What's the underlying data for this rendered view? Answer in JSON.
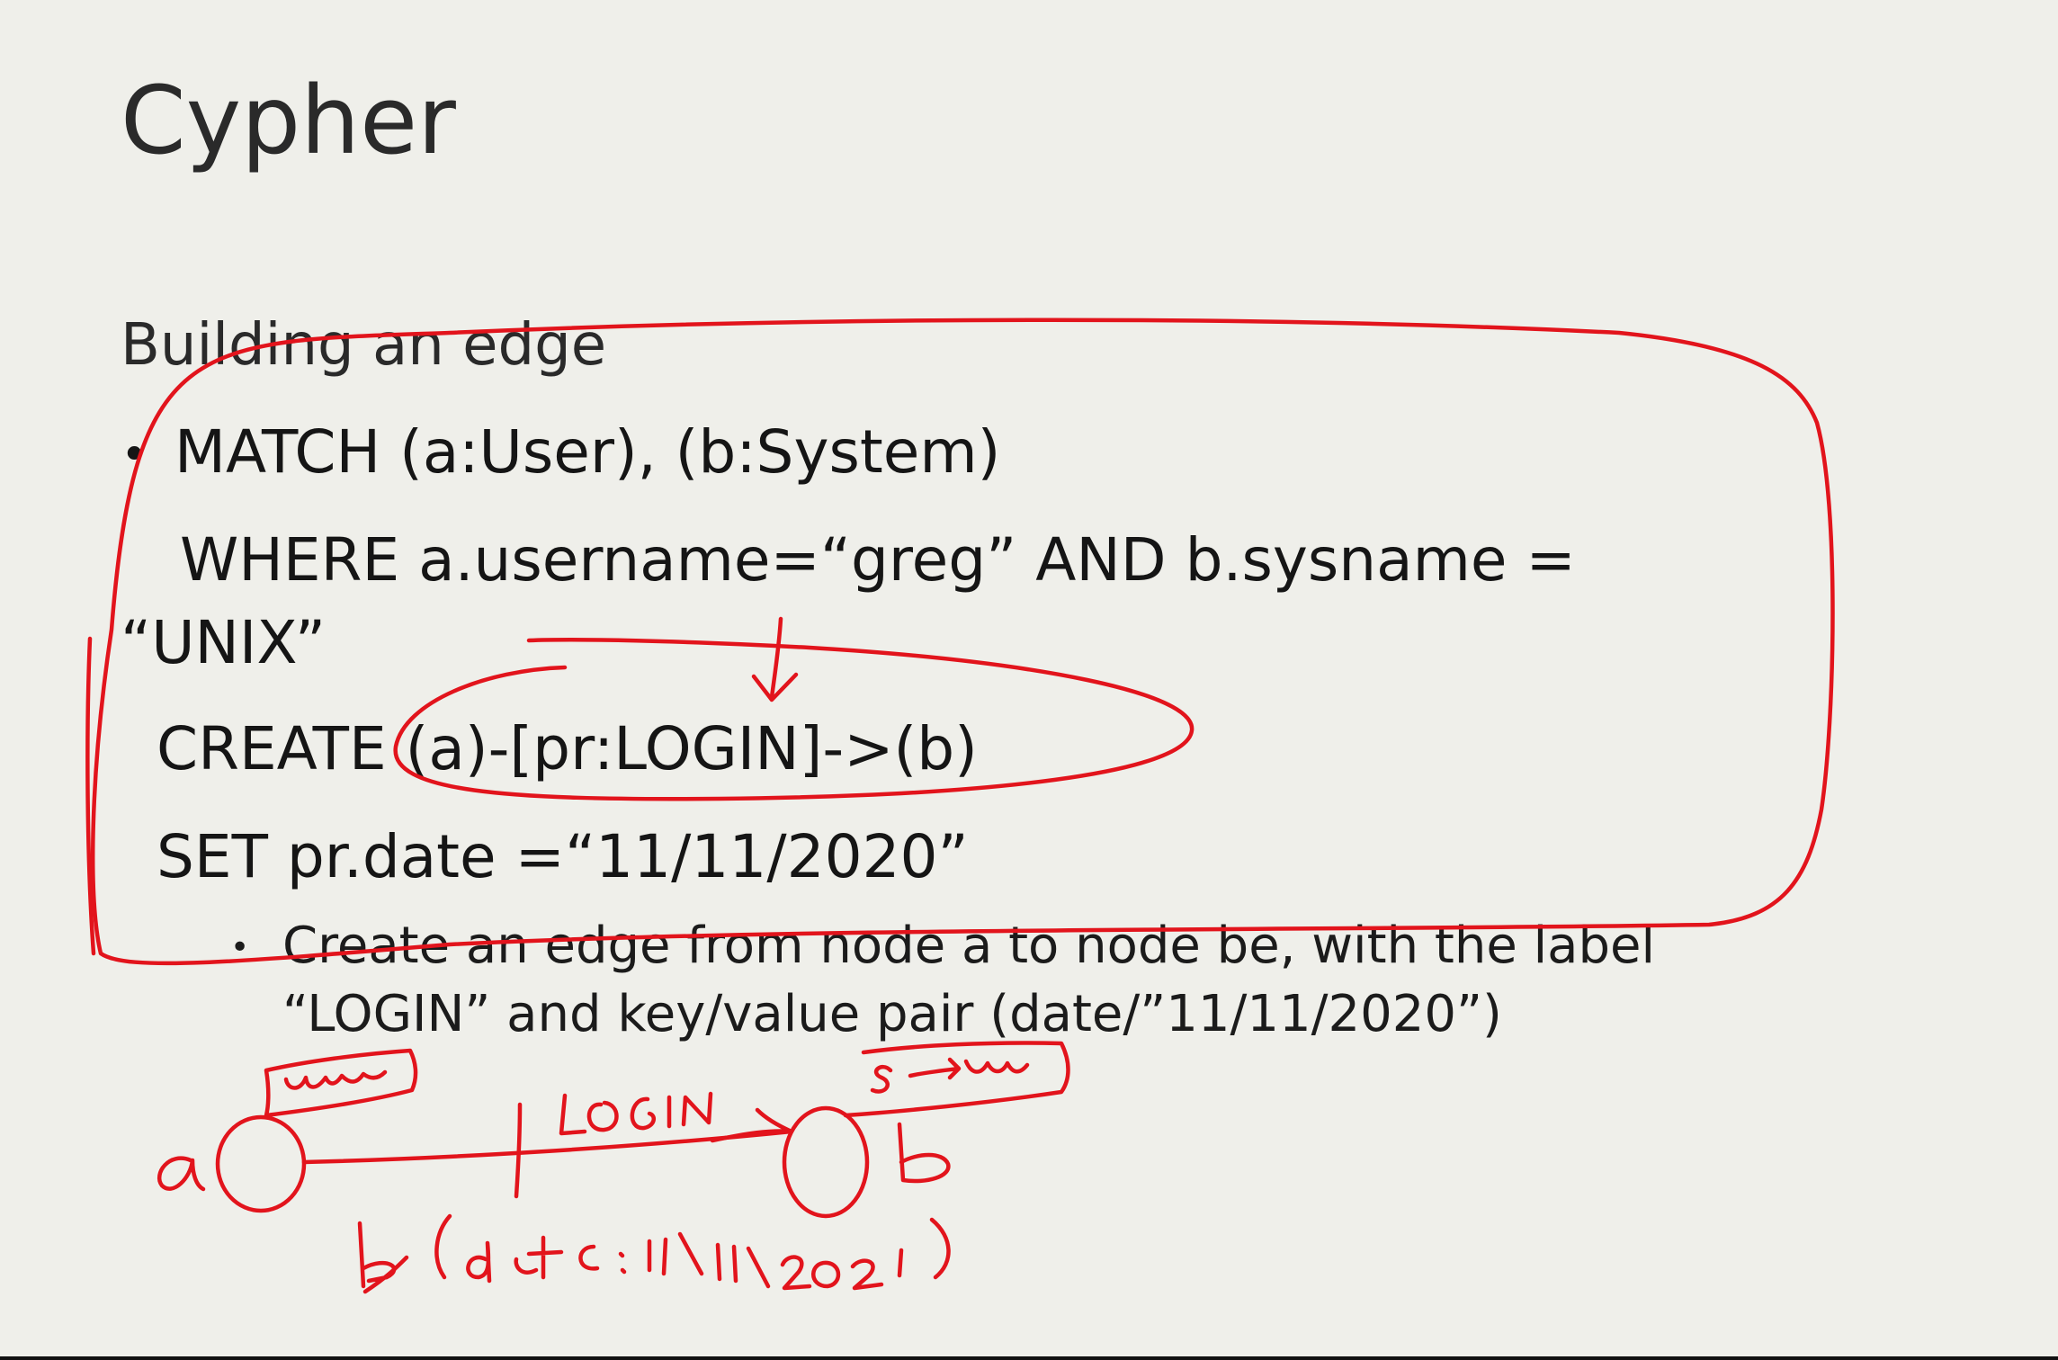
{
  "slide": {
    "title": "Cypher",
    "subtitle": "Building an edge",
    "code_lines": [
      "MATCH (a:User), (b:System)",
      "WHERE a.username=“greg” AND b.sysname =",
      "“UNIX”",
      "CREATE (a)-[pr:LOGIN]->(b)",
      "SET pr.date =“11/11/2020”"
    ],
    "sub_bullet_lines": [
      "Create an edge from node a to node be, with the label",
      "“LOGIN” and key/value pair (date/”11/11/2020”)"
    ]
  },
  "annotation": {
    "color": "#e2141c",
    "description_free": true
  }
}
